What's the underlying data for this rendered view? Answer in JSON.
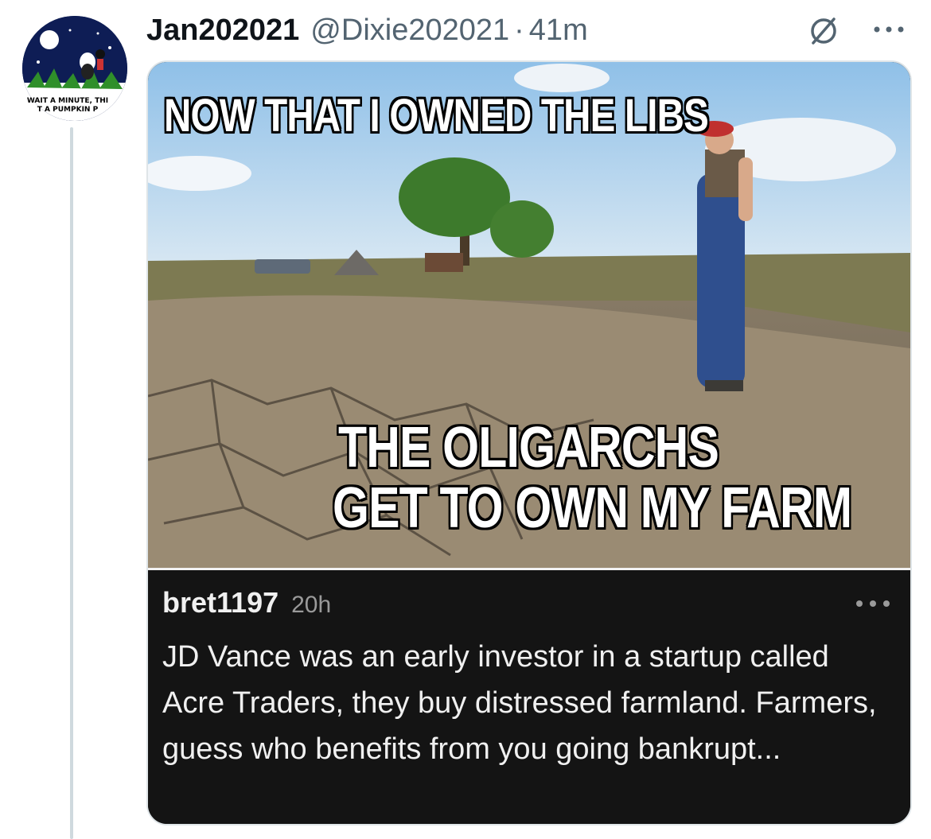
{
  "tweet": {
    "display_name": "Jan202021",
    "handle": "@Dixie202021",
    "separator": "·",
    "time": "41m",
    "avatar_caption_line1": "WAIT A MINUTE, THI",
    "avatar_caption_line2": "T A PUMPKIN P",
    "icons": {
      "muted": "muted-circle-slash-icon",
      "more": "more-horizontal-icon"
    }
  },
  "meme": {
    "top_text": "NOW THAT I OWNED THE LIBS",
    "bottom_line1": "THE OLIGARCHS",
    "bottom_line2": "GET TO OWN MY FARM"
  },
  "comment": {
    "username": "bret1197",
    "age": "20h",
    "body": "JD Vance was an early investor in a startup called Acre Traders, they buy distressed farmland. Farmers, guess who benefits from you going bankrupt..."
  },
  "colors": {
    "name": "#0f1419",
    "secondary": "#536471",
    "thread_line": "#cfd9de",
    "comment_bg": "#141414"
  }
}
